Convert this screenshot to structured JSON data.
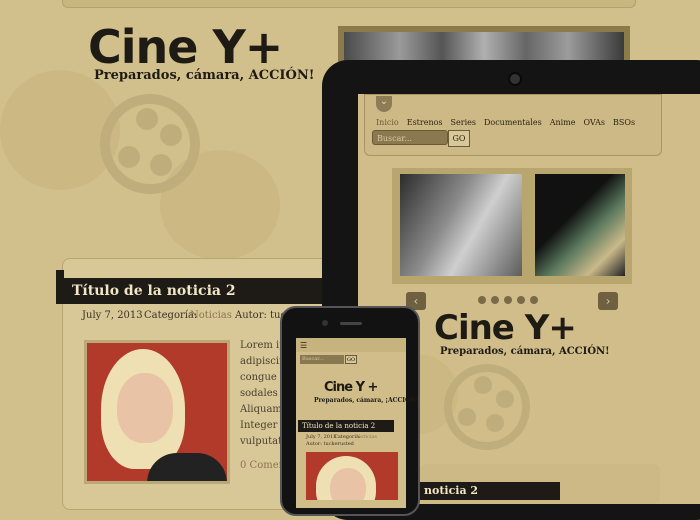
{
  "desktop": {
    "logo": "Cine Y+",
    "tagline": "Preparados, cámara, ACCIÓN!",
    "post_title": "Título de la noticia 2",
    "post_date": "July 7, 2013",
    "post_category_label": "Categoría:",
    "post_category": "Noticias",
    "post_author_label": "Autor: tuc",
    "post_excerpt": "Lorem ip\nadipiscin\ncongue f\nsodales\nAliquam e\nInteger\nvulputat\ndictum",
    "post_comments": "0 Comen"
  },
  "tablet": {
    "nav_items": [
      "Inicio",
      "Estrenos",
      "Series",
      "Documentales",
      "Anime",
      "OVAs",
      "BSOs"
    ],
    "search_placeholder": "Buscar...",
    "go_label": "GO",
    "logo": "Cine Y+",
    "tagline": "Preparados, cámara, ACCIÓN!",
    "post_title": "noticia 2",
    "slider_dots": 5
  },
  "phone": {
    "search_placeholder": "Buscar...",
    "go_label": "GO",
    "logo": "Cine Y +",
    "tagline": "Preparados, cámara, ¡ACCIÓN!",
    "post_title": "Título de la noticia 2",
    "post_date": "July 7, 2013",
    "post_category_label": "Categoría:",
    "post_category": "Noticias",
    "post_author": "Autor: tuckerusted"
  },
  "colors": {
    "background": "#d2c08c",
    "dark": "#1e1b17",
    "accent": "#8a7550"
  }
}
